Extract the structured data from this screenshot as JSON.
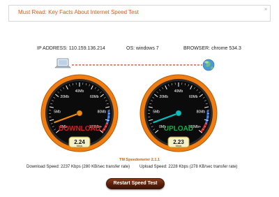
{
  "banner": {
    "text": "Must Read: Key Facts About Internet Speed Test",
    "arrow_icon": "double-chevron-right-icon"
  },
  "info": {
    "ip_label": "IP ADDRESS:",
    "ip_value": "110.159.136.214",
    "os_label": "OS:",
    "os_value": "windows 7",
    "browser_label": "BROWSER:",
    "browser_value": "chrome 534.3"
  },
  "connection": {
    "left_icon": "laptop-icon",
    "right_icon": "globe-icon",
    "line_color": "#d93a1a"
  },
  "gauges": [
    {
      "id": "download",
      "title": "DOWNLOAD",
      "title_color": "#d21f1f",
      "needle_color": "#f08a00",
      "speed_value": "2.24",
      "unit": "Mbps",
      "speed_mbps": 2.24,
      "ticks": [
        "0Mb",
        "5Mb",
        "20Mb",
        "40Mb",
        "60Mb",
        "80Mb",
        "100Mb+"
      ]
    },
    {
      "id": "upload",
      "title": "UPLOAD",
      "title_color": "#1fa64a",
      "needle_color": "#00c0c0",
      "speed_value": "2.23",
      "unit": "Mbps",
      "speed_mbps": 2.23,
      "ticks": [
        "0Mb",
        "5Mb",
        "20Mb",
        "40Mb",
        "60Mb",
        "80Mb",
        "100Mb+"
      ]
    }
  ],
  "footer": {
    "title": "TM Speedometer 2.1.1",
    "download_stat": "Download Speed: 2237 Kbps (280 KB/sec transfer rate)",
    "upload_stat": "Upload Speed: 2228 Kbps (278 KB/sec transfer rate)"
  },
  "restart_button": {
    "label": "Restart Speed Test"
  }
}
